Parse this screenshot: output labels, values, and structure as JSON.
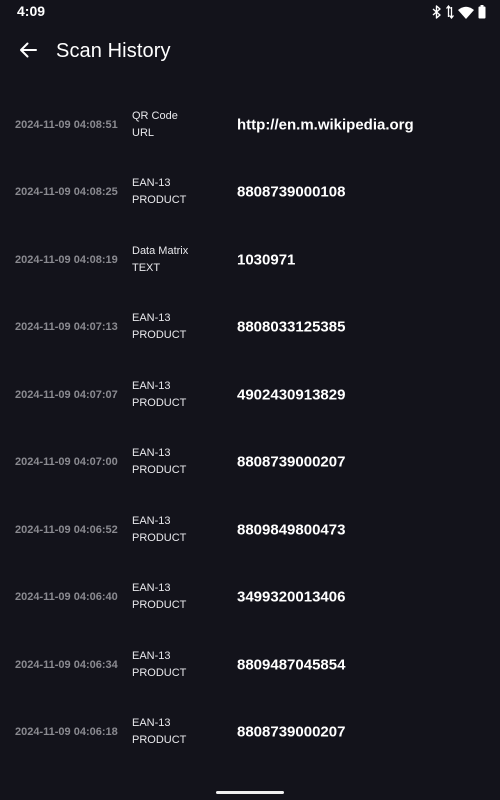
{
  "status_bar": {
    "time": "4:09",
    "icons": [
      "bluetooth-icon",
      "data-arrows-icon",
      "wifi-icon",
      "battery-icon"
    ]
  },
  "app_bar": {
    "back_icon": "arrow-left-icon",
    "title": "Scan History"
  },
  "history": [
    {
      "timestamp": "2024-11-09 04:08:51",
      "format": "QR Code",
      "type": "URL",
      "value": "http://en.m.wikipedia.org"
    },
    {
      "timestamp": "2024-11-09 04:08:25",
      "format": "EAN-13",
      "type": "PRODUCT",
      "value": "8808739000108"
    },
    {
      "timestamp": "2024-11-09 04:08:19",
      "format": "Data Matrix",
      "type": "TEXT",
      "value": "1030971"
    },
    {
      "timestamp": "2024-11-09 04:07:13",
      "format": "EAN-13",
      "type": "PRODUCT",
      "value": "8808033125385"
    },
    {
      "timestamp": "2024-11-09 04:07:07",
      "format": "EAN-13",
      "type": "PRODUCT",
      "value": "4902430913829"
    },
    {
      "timestamp": "2024-11-09 04:07:00",
      "format": "EAN-13",
      "type": "PRODUCT",
      "value": "8808739000207"
    },
    {
      "timestamp": "2024-11-09 04:06:52",
      "format": "EAN-13",
      "type": "PRODUCT",
      "value": "8809849800473"
    },
    {
      "timestamp": "2024-11-09 04:06:40",
      "format": "EAN-13",
      "type": "PRODUCT",
      "value": "3499320013406"
    },
    {
      "timestamp": "2024-11-09 04:06:34",
      "format": "EAN-13",
      "type": "PRODUCT",
      "value": "8809487045854"
    },
    {
      "timestamp": "2024-11-09 04:06:18",
      "format": "EAN-13",
      "type": "PRODUCT",
      "value": "8808739000207"
    }
  ],
  "colors": {
    "background": "#13131b",
    "timestamp": "#8a8a90",
    "text": "#ffffff"
  }
}
